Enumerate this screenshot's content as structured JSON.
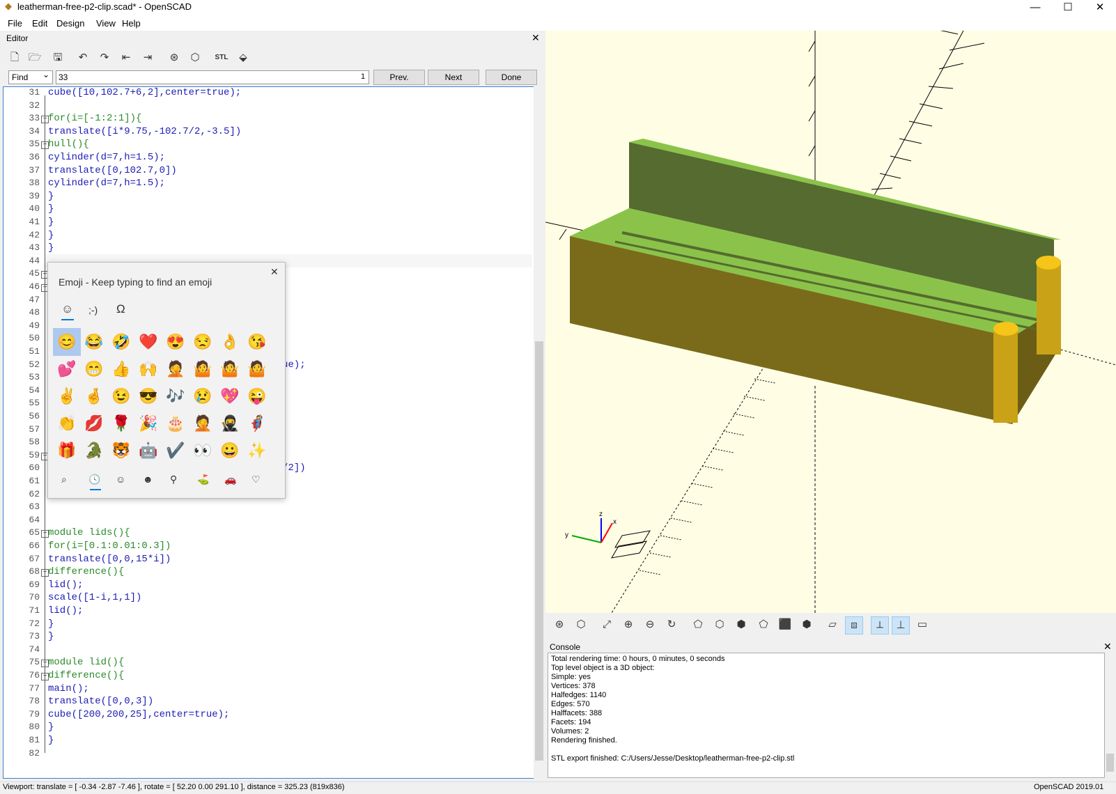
{
  "window": {
    "title": "leatherman-free-p2-clip.scad* - OpenSCAD",
    "minimize": "—",
    "maximize": "☐",
    "close": "✕"
  },
  "menu": {
    "file": "File",
    "edit": "Edit",
    "design": "Design",
    "view": "View",
    "help": "Help"
  },
  "editor": {
    "title": "Editor",
    "close": "✕",
    "find": {
      "mode": "Find",
      "query": "33",
      "count": "1",
      "prev": "Prev.",
      "next": "Next",
      "done": "Done"
    },
    "lines": [
      {
        "n": "31",
        "code": "cube([10,102.7+6,2],center=true);"
      },
      {
        "n": "32",
        "code": ""
      },
      {
        "n": "33",
        "code": "for(i=[-1:2:1]){"
      },
      {
        "n": "34",
        "code": "translate([i*9.75,-102.7/2,-3.5])"
      },
      {
        "n": "35",
        "code": "hull(){"
      },
      {
        "n": "36",
        "code": "cylinder(d=7,h=1.5);"
      },
      {
        "n": "37",
        "code": "translate([0,102.7,0])"
      },
      {
        "n": "38",
        "code": "cylinder(d=7,h=1.5);"
      },
      {
        "n": "39",
        "code": "}"
      },
      {
        "n": "40",
        "code": "}"
      },
      {
        "n": "41",
        "code": "}"
      },
      {
        "n": "42",
        "code": "}"
      },
      {
        "n": "43",
        "code": "}"
      },
      {
        "n": "44",
        "code": ""
      },
      {
        "n": "45",
        "code": ""
      },
      {
        "n": "46",
        "code": ""
      },
      {
        "n": "47",
        "code": ""
      },
      {
        "n": "48",
        "code": ""
      },
      {
        "n": "49",
        "code": ""
      },
      {
        "n": "50",
        "code": ""
      },
      {
        "n": "51",
        "code": ""
      },
      {
        "n": "52",
        "code": "                                   er=true);"
      },
      {
        "n": "53",
        "code": ""
      },
      {
        "n": "54",
        "code": ""
      },
      {
        "n": "55",
        "code": "                                   );"
      },
      {
        "n": "56",
        "code": ""
      },
      {
        "n": "57",
        "code": ""
      },
      {
        "n": "58",
        "code": ""
      },
      {
        "n": "59",
        "code": ""
      },
      {
        "n": "60",
        "code": "                                 19.6-3)/2])"
      },
      {
        "n": "61",
        "code": ""
      },
      {
        "n": "62",
        "code": "}"
      },
      {
        "n": "63",
        "code": ""
      },
      {
        "n": "64",
        "code": ""
      },
      {
        "n": "65",
        "code": "module lids(){"
      },
      {
        "n": "66",
        "code": "for(i=[0.1:0.01:0.3])"
      },
      {
        "n": "67",
        "code": "translate([0,0,15*i])"
      },
      {
        "n": "68",
        "code": "difference(){"
      },
      {
        "n": "69",
        "code": "lid();"
      },
      {
        "n": "70",
        "code": "scale([1-i,1,1])"
      },
      {
        "n": "71",
        "code": "lid();"
      },
      {
        "n": "72",
        "code": "}"
      },
      {
        "n": "73",
        "code": "}"
      },
      {
        "n": "74",
        "code": ""
      },
      {
        "n": "75",
        "code": "module lid(){"
      },
      {
        "n": "76",
        "code": "difference(){"
      },
      {
        "n": "77",
        "code": "main();"
      },
      {
        "n": "78",
        "code": "translate([0,0,3])"
      },
      {
        "n": "79",
        "code": "cube([200,200,25],center=true);"
      },
      {
        "n": "80",
        "code": "}"
      },
      {
        "n": "81",
        "code": "}"
      },
      {
        "n": "82",
        "code": ""
      }
    ]
  },
  "emoji_panel": {
    "title": "Emoji - Keep typing to find an emoji",
    "close": "✕",
    "tabs": [
      "☺",
      ";-)",
      "Ω"
    ],
    "emojis": [
      "😊",
      "😂",
      "🤣",
      "❤️",
      "😍",
      "😒",
      "👌",
      "😘",
      "💕",
      "😁",
      "👍",
      "🙌",
      "🤦",
      "🤷",
      "🤷",
      "🤷",
      "✌️",
      "🤞",
      "😉",
      "😎",
      "🎶",
      "😢",
      "💖",
      "😜",
      "👏",
      "💋",
      "🌹",
      "🎉",
      "🎂",
      "🤦",
      "🥷",
      "🦸",
      "🎁",
      "🐊",
      "🐯",
      "🤖",
      "✔️",
      "👀",
      "😀",
      "✨"
    ],
    "categories": [
      "⌕",
      "🕓",
      "☺",
      "☻",
      "⚲",
      "⛳",
      "🚗",
      "♡"
    ]
  },
  "viewport_toolbar": {
    "icons": [
      "preview-icon",
      "render-icon",
      "view-all-icon",
      "zoom-in-icon",
      "zoom-out-icon",
      "reset-view-icon",
      "view-right-icon",
      "view-top-icon",
      "view-bottom-icon",
      "view-left-icon",
      "view-front-icon",
      "view-back-icon",
      "perspective-icon",
      "orthogonal-icon",
      "show-axes-icon",
      "show-scale-icon",
      "show-edges-icon"
    ],
    "glyphs": [
      "⊛",
      "⬡",
      "⤢",
      "⊕",
      "⊖",
      "↻",
      "⬠",
      "⬡",
      "⬢",
      "⬠",
      "⬛",
      "⬢",
      "▱",
      "⧈",
      "⟂",
      "⊥",
      "▭"
    ]
  },
  "console": {
    "title": "Console",
    "close": "✕",
    "lines": [
      "Total rendering time: 0 hours, 0 minutes, 0 seconds",
      "Top level object is a 3D object:",
      "Simple: yes",
      "Vertices: 378",
      "Halfedges: 1140",
      "Edges: 570",
      "Halffacets: 388",
      "Facets: 194",
      "Volumes: 2",
      "Rendering finished.",
      "",
      "STL export finished: C:/Users/Jesse/Desktop/leatherman-free-p2-clip.stl"
    ]
  },
  "status": {
    "viewport": "Viewport: translate = [ -0.34 -2.87 -7.46 ], rotate = [ 52.20 0.00 291.10 ], distance = 325.23 (819x836)",
    "version": "OpenSCAD 2019.01"
  },
  "axes": {
    "x": "x",
    "y": "y",
    "z": "z"
  },
  "colors": {
    "model_top": "#8bc34a",
    "model_front": "#7a6b1a",
    "model_wall": "#556b2f",
    "cylinder": "#f5c518",
    "viewport_bg": "#fffee5"
  }
}
